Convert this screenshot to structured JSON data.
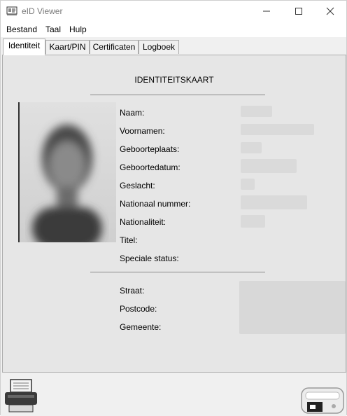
{
  "window": {
    "title": "eID Viewer"
  },
  "menu": {
    "items": [
      "Bestand",
      "Taal",
      "Hulp"
    ]
  },
  "tabs": [
    "Identiteit",
    "Kaart/PIN",
    "Certificaten",
    "Logboek"
  ],
  "card": {
    "title": "IDENTITEITSKAART",
    "fields": [
      "Naam:",
      "Voornamen:",
      "Geboorteplaats:",
      "Geboortedatum:",
      "Geslacht:",
      "Nationaal nummer:",
      "Nationaliteit:",
      "Titel:",
      "Speciale status:"
    ],
    "address_fields": [
      "Straat:",
      "Postcode:",
      "Gemeente:"
    ]
  },
  "icons": {
    "app": "eid-app-icon",
    "print": "printer-icon",
    "reader": "card-reader-icon"
  }
}
